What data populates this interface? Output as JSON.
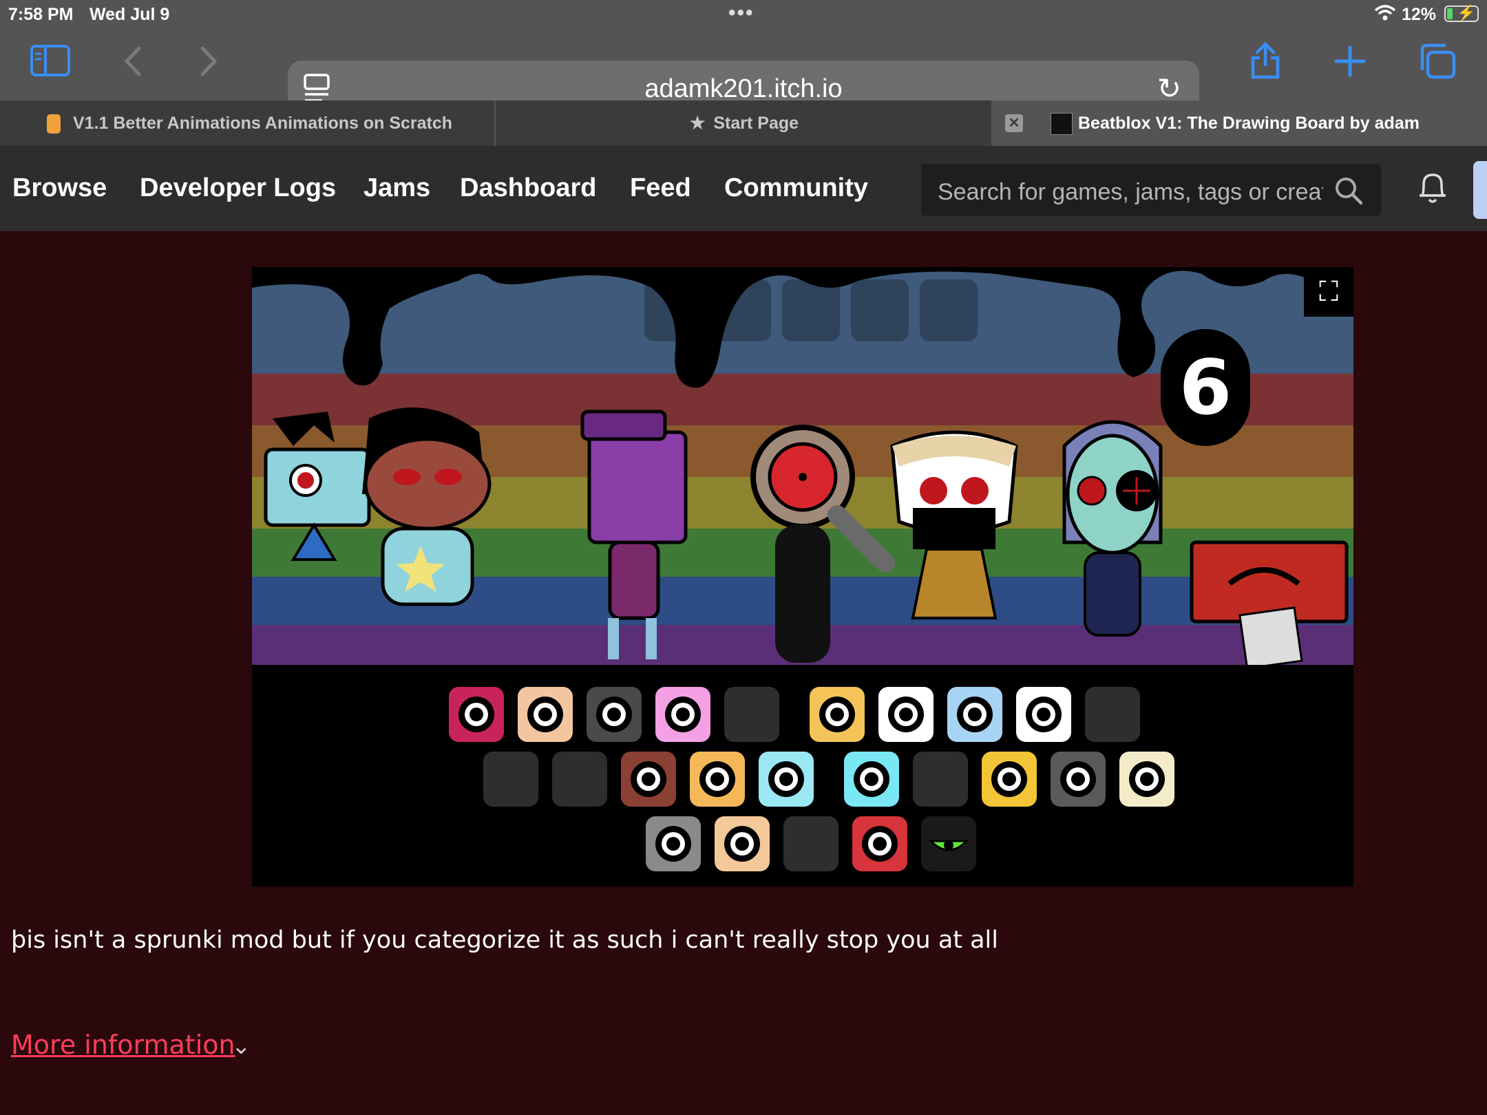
{
  "status_bar": {
    "time": "7:58 PM",
    "date": "Wed Jul 9",
    "battery": "12%"
  },
  "browser": {
    "url": "adamk201.itch.io",
    "tabs": [
      {
        "label": "V1.1 Better Animations Animations on Scratch"
      },
      {
        "label": "Start Page"
      },
      {
        "label": "Beatblox V1: The Drawing Board by adam"
      }
    ]
  },
  "site_nav": {
    "items": [
      "Browse",
      "Developer Logs",
      "Jams",
      "Dashboard",
      "Feed",
      "Community"
    ],
    "search_placeholder": "Search for games, jams, tags or creat"
  },
  "game": {
    "beat_number": "6"
  },
  "description": "þis isn't a sprunki mod but if you categorize it as such i can't really stop you at all",
  "more_info": "More information",
  "colors": {
    "page_bg": "#2a080c",
    "link": "#ff3d5a",
    "accent": "#3a8ef5"
  }
}
